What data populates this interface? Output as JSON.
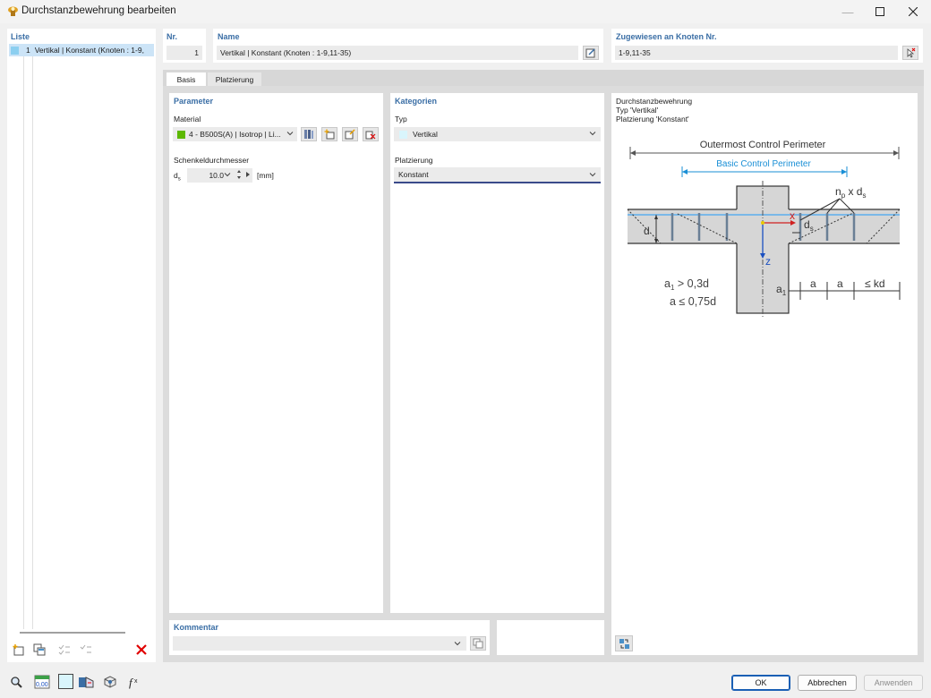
{
  "window": {
    "title": "Durchstanzbewehrung bearbeiten"
  },
  "list": {
    "header": "Liste",
    "items": [
      {
        "number": "1",
        "label": "Vertikal | Konstant (Knoten : 1-9,"
      }
    ]
  },
  "nr": {
    "label": "Nr.",
    "value": "1"
  },
  "name": {
    "label": "Name",
    "value": "Vertikal | Konstant (Knoten : 1-9,11-35)"
  },
  "assigned": {
    "label": "Zugewiesen an Knoten Nr.",
    "value": "1-9,11-35"
  },
  "tabs": [
    {
      "label": "Basis",
      "active": true
    },
    {
      "label": "Platzierung",
      "active": false
    }
  ],
  "parameter": {
    "header": "Parameter",
    "material_label": "Material",
    "material_value": "4 - B500S(A) | Isotrop | Li...",
    "material_color": "#5cb800",
    "diameter_label": "Schenkeldurchmesser",
    "ds_symbol": "d",
    "ds_sub": "s",
    "ds_value": "10.0",
    "ds_unit": "[mm]"
  },
  "categories": {
    "header": "Kategorien",
    "type_label": "Typ",
    "type_value": "Vertikal",
    "placement_label": "Platzierung",
    "placement_value": "Konstant"
  },
  "info": {
    "line1": "Durchstanzbewehrung",
    "line2": "Typ 'Vertikal'",
    "line3": "Platzierung 'Konstant'"
  },
  "diagram": {
    "outer_label": "Outermost Control Perimeter",
    "basic_label": "Basic Control Perimeter",
    "np_label": "n",
    "np_sub": "p",
    "x_ds": " x d",
    "ds_sub": "s",
    "d_label": "d",
    "x_axis": "x",
    "z_axis": "z",
    "ds_near": "d",
    "ds_near_sub": "s",
    "a1_label": "a",
    "a1_sub": "1",
    "a_label": "a",
    "kd_label": "≤ kd",
    "cond1": "a",
    "cond1_sub": "1",
    "cond1_rest": " > 0,3d",
    "cond2": "a ≤ 0,75d"
  },
  "comment": {
    "label": "Kommentar",
    "value": ""
  },
  "buttons": {
    "ok": "OK",
    "cancel": "Abbrechen",
    "apply": "Anwenden"
  },
  "bottom_icons": [
    "search-icon",
    "units-icon",
    "color-icon",
    "model-icon",
    "view-icon",
    "function-icon"
  ]
}
